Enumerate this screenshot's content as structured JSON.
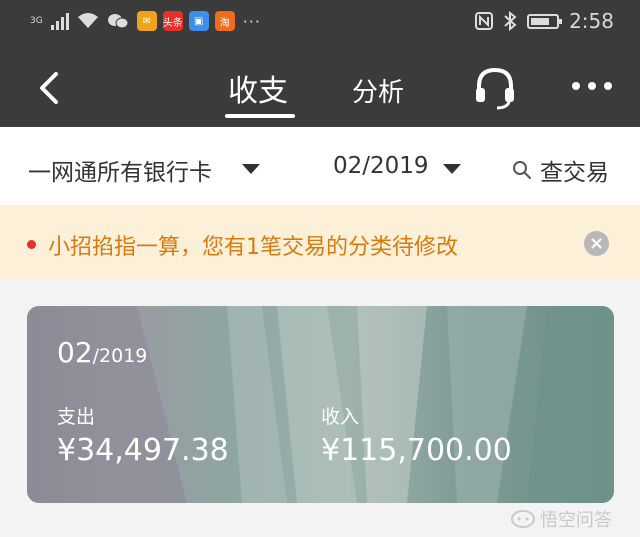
{
  "status_bar": {
    "network": "3G",
    "time": "2:58",
    "app_icons": [
      {
        "name": "mail-icon",
        "label": "✉",
        "color": "#f0a318"
      },
      {
        "name": "toutiao-icon",
        "label": "头条",
        "color": "#e8302a"
      },
      {
        "name": "delivery-icon",
        "label": "▣",
        "color": "#3c8ee8"
      },
      {
        "name": "taobao-icon",
        "label": "淘",
        "color": "#f26b1d"
      }
    ]
  },
  "nav": {
    "tab_income": "收支",
    "tab_analysis": "分析"
  },
  "filter": {
    "bank": "一网通所有银行卡",
    "month": "02/2019",
    "search": "查交易"
  },
  "notice": {
    "message": "小招掐指一算，您有1笔交易的分类待修改"
  },
  "card": {
    "period_month": "02",
    "period_year": "/2019",
    "expense_label": "支出",
    "expense_amount": "¥34,497.38",
    "income_label": "收入",
    "income_amount": "¥115,700.00"
  },
  "watermark": {
    "text": "悟空问答"
  },
  "colors": {
    "header_bg": "#3b3b3b",
    "notice_bg": "#fdf0d8",
    "notice_text": "#d97a10",
    "notice_dot": "#e8302a"
  }
}
